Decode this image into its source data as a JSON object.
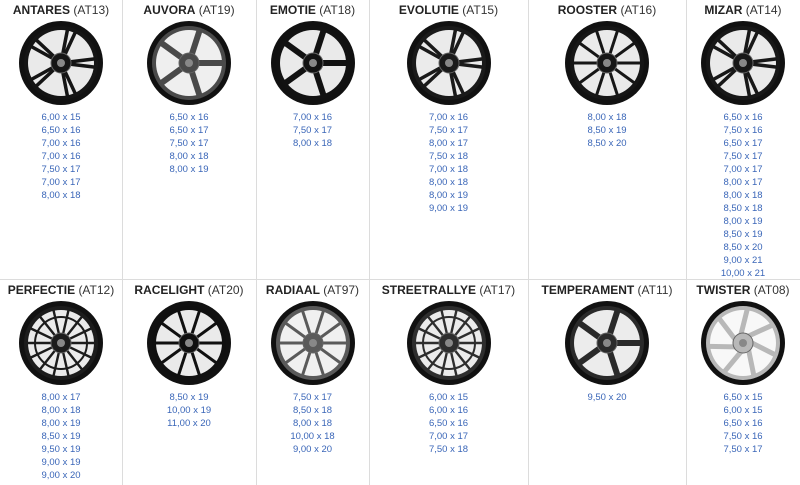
{
  "rows": [
    [
      {
        "name": "ANTARES",
        "code": "(AT13)",
        "color": "#151515",
        "spokes": "double",
        "sizes": [
          "6,00 x 15",
          "6,50 x 16",
          "7,00 x 16",
          "7,00 x 16",
          "7,50 x 17",
          "7,00 x 17",
          "8,00 x 18"
        ]
      },
      {
        "name": "AUVORA",
        "code": "(AT19)",
        "color": "#4a4a4a",
        "spokes": "five",
        "sizes": [
          "6,50 x 16",
          "6,50 x 17",
          "7,50 x 17",
          "8,00 x 18",
          "8,00 x 19"
        ]
      },
      {
        "name": "EMOTIE",
        "code": "(AT18)",
        "color": "#121212",
        "spokes": "five",
        "sizes": [
          "7,00 x 16",
          "7,50 x 17",
          "8,00 x 18"
        ]
      },
      {
        "name": "EVOLUTIE",
        "code": "(AT15)",
        "color": "#1a1a1a",
        "spokes": "double",
        "sizes": [
          "7,00 x 16",
          "7,50 x 17",
          "8,00 x 17",
          "7,50 x 18",
          "7,00 x 18",
          "8,00 x 18",
          "8,00 x 19",
          "9,00 x 19"
        ]
      },
      {
        "name": "ROOSTER",
        "code": "(AT16)",
        "color": "#161616",
        "spokes": "multi",
        "sizes": [
          "8,00 x 18",
          "8,50 x 19",
          "8,50 x 20"
        ]
      },
      {
        "name": "MIZAR",
        "code": "(AT14)",
        "color": "#181818",
        "spokes": "double",
        "sizes": [
          "6,50 x 16",
          "7,50 x 16",
          "6,50 x 17",
          "7,50 x 17",
          "7,00 x 17",
          "8,00 x 17",
          "8,00 x 18",
          "8,50 x 18",
          "8,00 x 19",
          "8,50 x 19",
          "8,50 x 20",
          "9,00 x 21",
          "10,00 x 21"
        ]
      }
    ],
    [
      {
        "name": "PERFECTIE",
        "code": "(AT12)",
        "color": "#1c1c1c",
        "spokes": "mesh",
        "sizes": [
          "8,00 x 17",
          "8,00 x 18",
          "8,00 x 19",
          "8,50 x 19",
          "9,50 x 19",
          "9,00 x 19",
          "9,00 x 20"
        ]
      },
      {
        "name": "RACELIGHT",
        "code": "(AT20)",
        "color": "#101010",
        "spokes": "multi",
        "sizes": [
          "8,50 x 19",
          "10,00 x 19",
          "11,00 x 20"
        ]
      },
      {
        "name": "RADIAAL",
        "code": "(AT97)",
        "color": "#5a5a5a",
        "spokes": "multi",
        "sizes": [
          "7,50 x 17",
          "8,50 x 18",
          "8,00 x 18",
          "10,00 x 18",
          "9,00 x 20"
        ]
      },
      {
        "name": "STREETRALLYE",
        "code": "(AT17)",
        "color": "#2e2e2e",
        "spokes": "mesh",
        "sizes": [
          "6,00 x 15",
          "6,00 x 16",
          "6,50 x 16",
          "7,00 x 17",
          "7,50 x 18"
        ]
      },
      {
        "name": "TEMPERAMENT",
        "code": "(AT11)",
        "color": "#2a2a2a",
        "spokes": "five",
        "sizes": [
          "9,50 x 20"
        ]
      },
      {
        "name": "TWISTER",
        "code": "(AT08)",
        "color": "#b8b8b8",
        "spokes": "twist",
        "sizes": [
          "6,50 x 15",
          "6,00 x 15",
          "6,50 x 16",
          "7,50 x 16",
          "7,50 x 17"
        ]
      }
    ]
  ]
}
